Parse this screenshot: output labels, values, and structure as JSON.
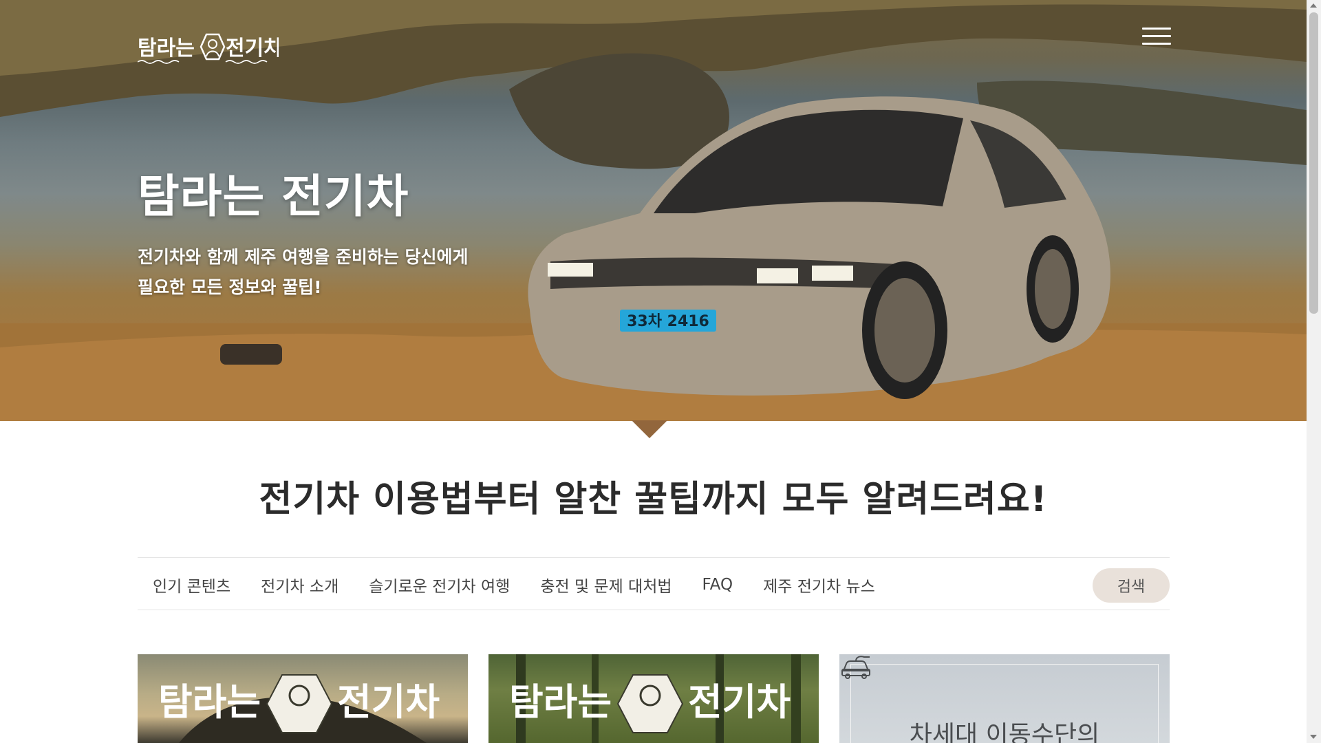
{
  "brand": {
    "logo_text": "탐라는 전기차"
  },
  "hero": {
    "title": "탐라는 전기차",
    "subtitle_line1": "전기차와 함께 제주 여행을 준비하는 당신에게",
    "subtitle_line2": "필요한 모든 정보와 꿀팁!",
    "plate_text": "33차 2416"
  },
  "section": {
    "title": "전기차 이용법부터 알찬 꿀팁까지 모두 알려드려요!"
  },
  "nav": {
    "items": [
      {
        "label": "인기 콘텐츠"
      },
      {
        "label": "전기차 소개"
      },
      {
        "label": "슬기로운 전기차 여행"
      },
      {
        "label": "충전 및 문제 대처법"
      },
      {
        "label": "FAQ"
      },
      {
        "label": "제주 전기차 뉴스"
      }
    ],
    "search_label": "검색"
  },
  "cards": [
    {
      "overlay_text": "탐라는 전기차"
    },
    {
      "overlay_text": "탐라는 전기차"
    },
    {
      "text": "차세대 이동수단의",
      "icon": "ev-car-plug-icon"
    }
  ],
  "colors": {
    "accent": "#e9e1da",
    "heading": "#2b2b2b",
    "hero_ground": "#a4773e"
  }
}
